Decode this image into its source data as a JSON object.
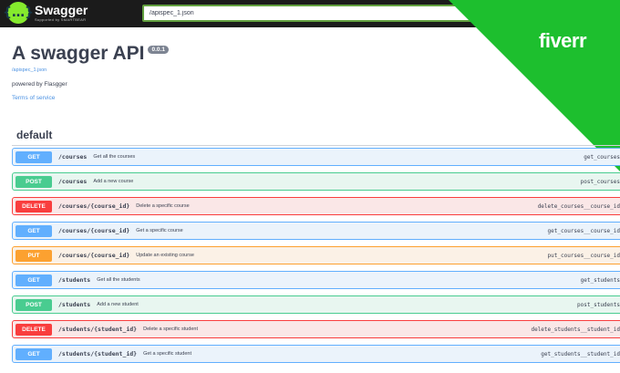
{
  "topbar": {
    "logo_name": "Swagger",
    "logo_sub": "Supported by SMARTBEAR",
    "url_value": "/apispec_1.json"
  },
  "watermark": {
    "text": "fiverr",
    "color": "#1dbf2e"
  },
  "info": {
    "title": "A swagger API",
    "version": "0.0.1",
    "spec_link": "/apispec_1.json",
    "powered_by": "powered by Flasgger",
    "terms": "Terms of service"
  },
  "section": {
    "title": "default"
  },
  "colors": {
    "get": "#61affe",
    "post": "#49cc90",
    "delete": "#f93e3e",
    "put": "#fca130"
  },
  "operations": [
    {
      "method": "GET",
      "path": "/courses",
      "summary": "Get all the courses",
      "op_id": "get_courses"
    },
    {
      "method": "POST",
      "path": "/courses",
      "summary": "Add a new course",
      "op_id": "post_courses"
    },
    {
      "method": "DELETE",
      "path": "/courses/{course_id}",
      "summary": "Delete a specific course",
      "op_id": "delete_courses__course_id"
    },
    {
      "method": "GET",
      "path": "/courses/{course_id}",
      "summary": "Get a specific course",
      "op_id": "get_courses__course_id"
    },
    {
      "method": "PUT",
      "path": "/courses/{course_id}",
      "summary": "Update an existing course",
      "op_id": "put_courses__course_id"
    },
    {
      "method": "GET",
      "path": "/students",
      "summary": "Get all the students",
      "op_id": "get_students"
    },
    {
      "method": "POST",
      "path": "/students",
      "summary": "Add a new student",
      "op_id": "post_students"
    },
    {
      "method": "DELETE",
      "path": "/students/{student_id}",
      "summary": "Delete a specific student",
      "op_id": "delete_students__student_id"
    },
    {
      "method": "GET",
      "path": "/students/{student_id}",
      "summary": "Get a specific student",
      "op_id": "get_students__student_id"
    }
  ]
}
